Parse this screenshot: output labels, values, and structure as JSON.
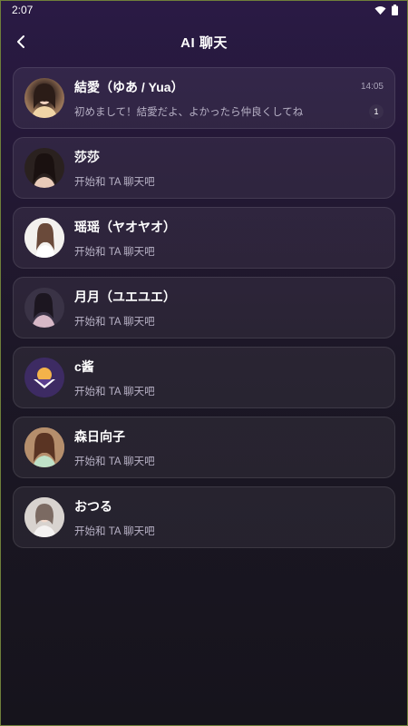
{
  "status_bar": {
    "time": "2:07"
  },
  "header": {
    "title": "AI 聊天"
  },
  "colors": {
    "accent": "#f4b34a",
    "card_bg": "rgba(255,255,255,0.06)"
  },
  "chats": [
    {
      "name": "結愛（ゆあ / Yua）",
      "message": "初めまして！結愛だよ、よかったら仲良くしてね",
      "time": "14:05",
      "unread": "1",
      "avatar": "photo"
    },
    {
      "name": "莎莎",
      "message": "开始和 TA 聊天吧",
      "avatar": "photo"
    },
    {
      "name": "瑶瑶（ヤオヤオ）",
      "message": "开始和 TA 聊天吧",
      "avatar": "photo"
    },
    {
      "name": "月月（ユエユエ）",
      "message": "开始和 TA 聊天吧",
      "avatar": "photo"
    },
    {
      "name": "c酱",
      "message": "开始和 TA 聊天吧",
      "avatar": "app-logo-icon"
    },
    {
      "name": "森日向子",
      "message": "开始和 TA 聊天吧",
      "avatar": "photo"
    },
    {
      "name": "おつる",
      "message": "开始和 TA 聊天吧",
      "avatar": "photo"
    }
  ]
}
